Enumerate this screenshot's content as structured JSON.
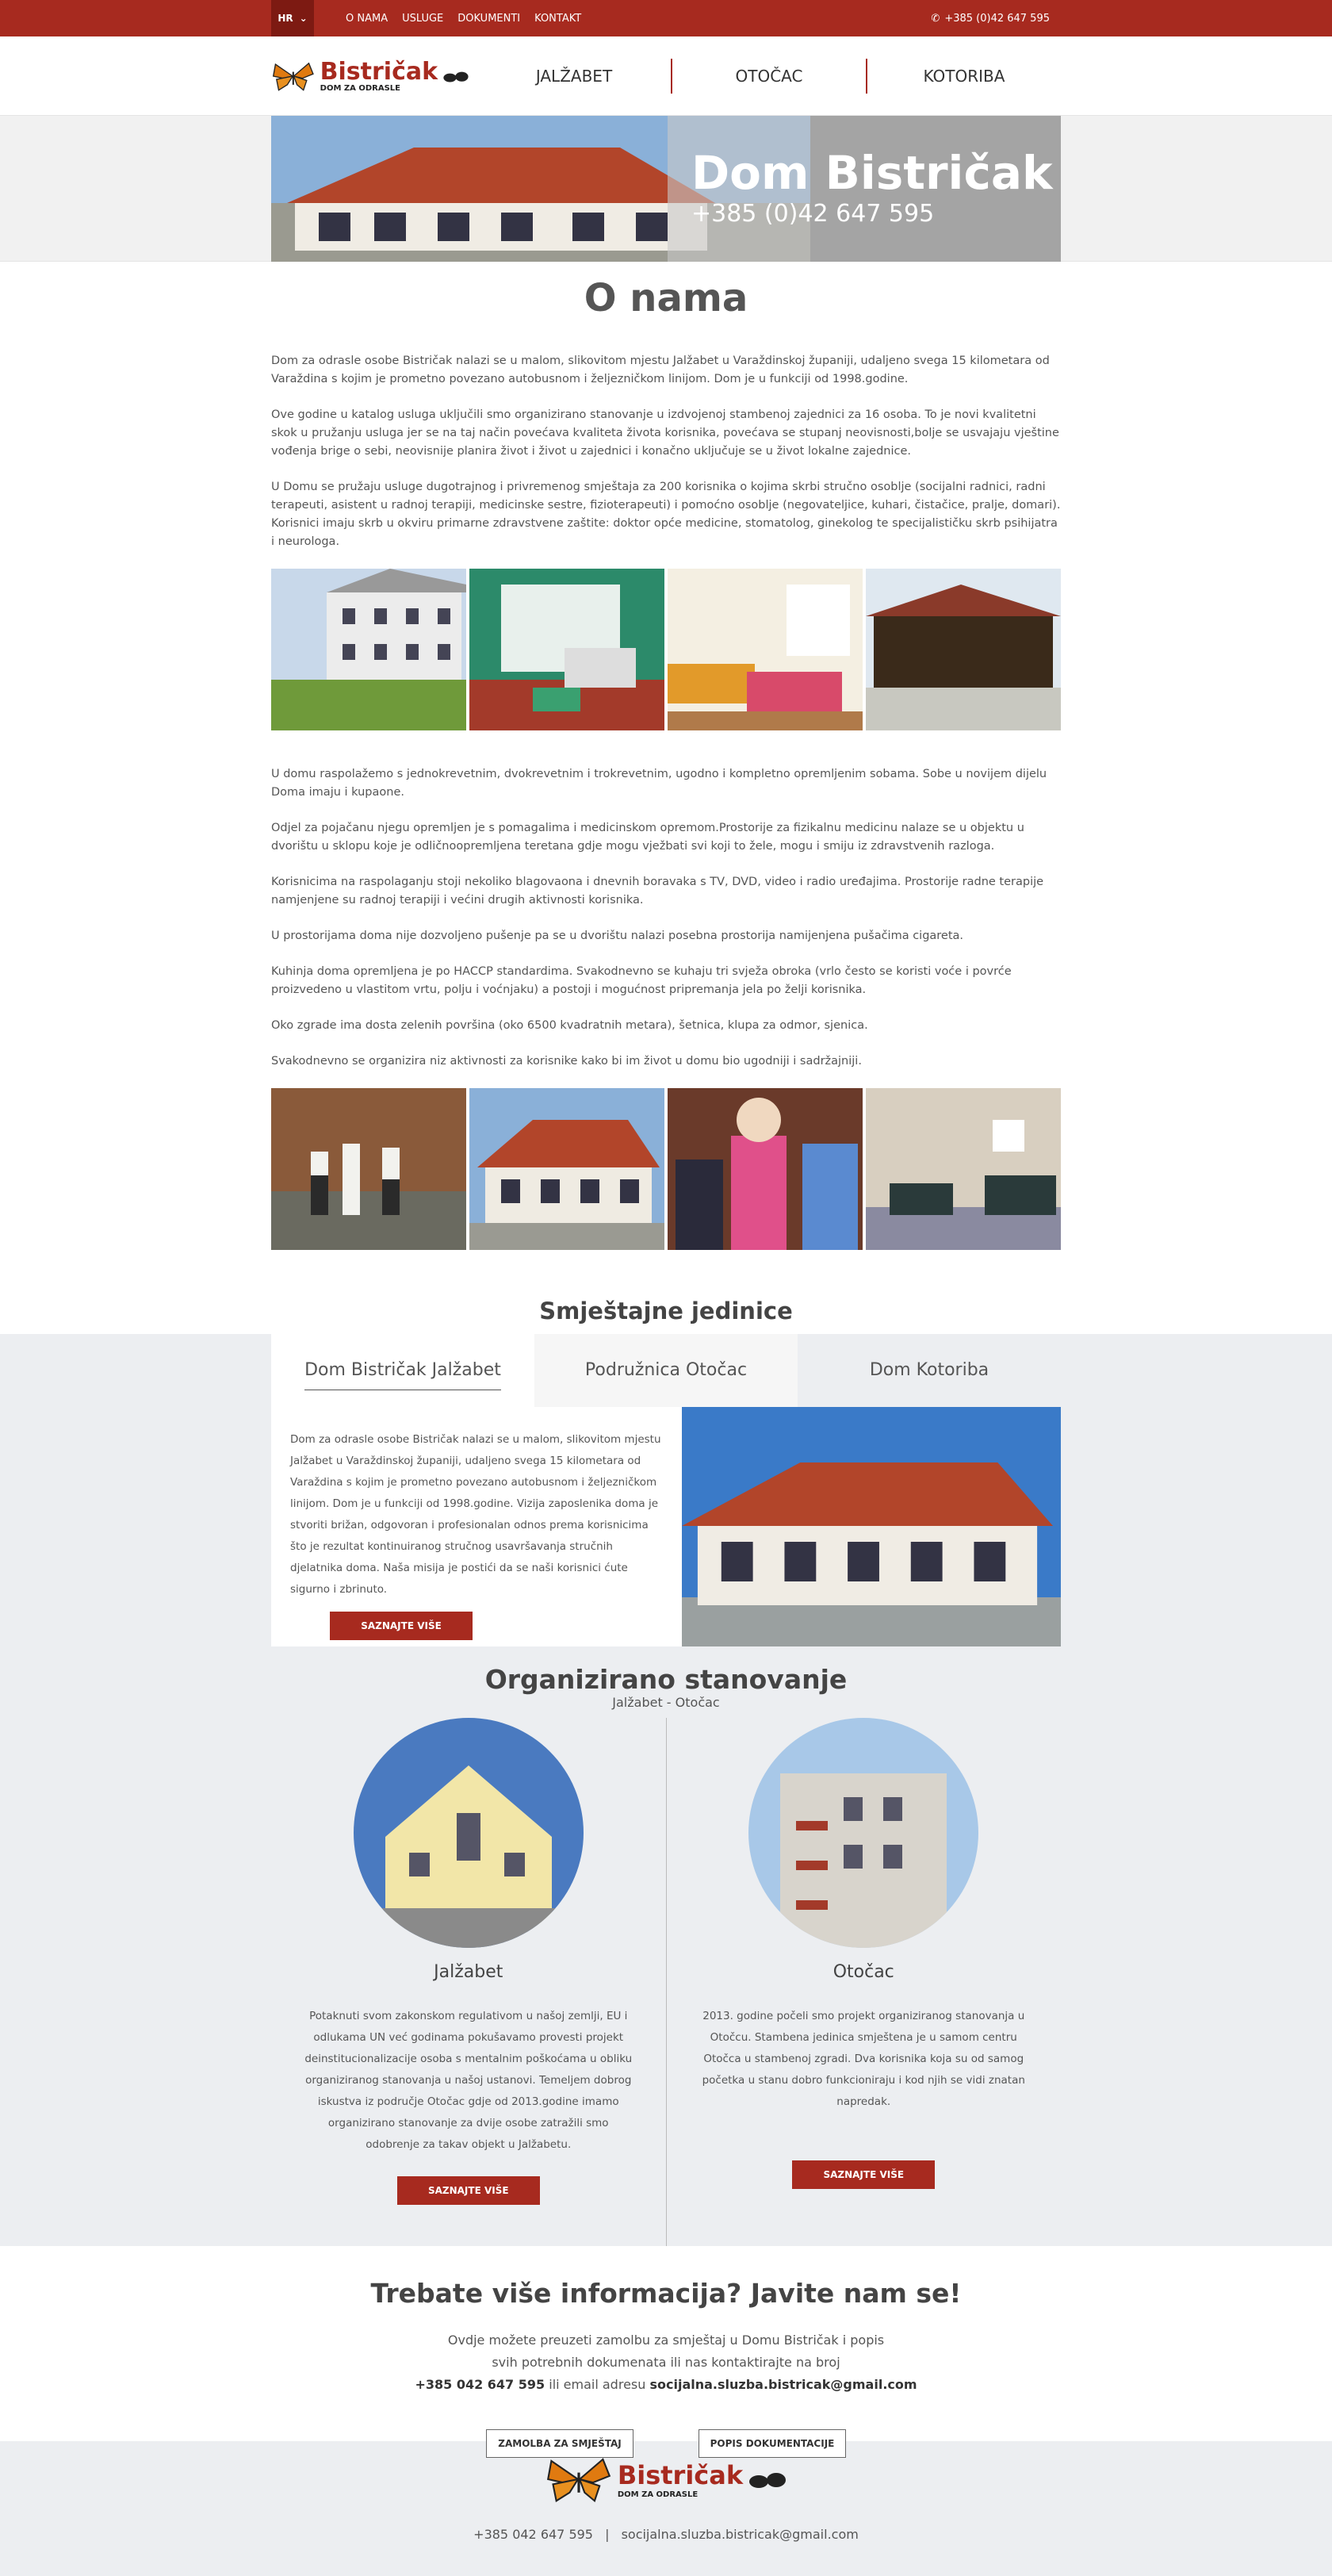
{
  "topbar": {
    "lang": "HR",
    "nav": [
      "O NAMA",
      "USLUGE",
      "DOKUMENTI",
      "KONTAKT"
    ],
    "phone": "+385 (0)42 647 595"
  },
  "header": {
    "logo_name": "Bistričak",
    "logo_sub": "DOM ZA ODRASLE",
    "nav": [
      "JALŽABET",
      "OTOČAC",
      "KOTORIBA"
    ]
  },
  "hero": {
    "title": "Dom Bistričak",
    "phone": "+385 (0)42 647 595"
  },
  "about": {
    "title": "O nama",
    "p1": "Dom za odrasle osobe Bistričak nalazi se u malom, slikovitom mjestu Jalžabet u Varaždinskoj županiji, udaljeno svega 15 kilometara od Varaždina s kojim je prometno povezano autobusnom i željezničkom linijom. Dom je u funkciji od 1998.godine.",
    "p2": "Ove godine u katalog usluga uključili smo organizirano stanovanje u izdvojenoj stambenoj zajednici za 16 osoba. To je novi kvalitetni skok u pružanju usluga jer se na taj način povećava kvaliteta života korisnika, povećava se stupanj neovisnosti,bolje se usvajaju vještine vođenja brige o sebi, neovisnije planira život i život u zajednici i konačno uključuje se u život lokalne zajednice.",
    "p3": "U Domu se pružaju usluge dugotrajnog i privremenog smještaja za 200 korisnika o kojima skrbi stručno osoblje (socijalni radnici, radni terapeuti, asistent u radnoj terapiji, medicinske sestre, fizioterapeuti) i pomoćno osoblje (negovateljice, kuhari, čistačice, pralje, domari). Korisnici imaju skrb u okviru primarne zdravstvene zaštite: doktor opće medicine, stomatolog, ginekolog te specijalističku skrb psihijatra i neurologa.",
    "p4": "U domu raspolažemo s jednokrevetnim, dvokrevetnim i trokrevetnim, ugodno i kompletno opremljenim sobama. Sobe u novijem dijelu Doma imaju i kupaone.",
    "p5": "Odjel za pojačanu njegu opremljen je s pomagalima i medicinskom opremom.Prostorije za fizikalnu medicinu nalaze se u objektu u dvorištu u sklopu koje je odličnoopremljena teretana gdje mogu vježbati svi koji to žele, mogu i smiju iz zdravstvenih razloga.",
    "p6": "Korisnicima na raspolaganju stoji nekoliko blagovaona i dnevnih boravaka s TV, DVD, video i radio uređajima. Prostorije radne terapije namjenjene su radnoj terapiji i većini drugih aktivnosti korisnika.",
    "p7": "U prostorijama doma nije dozvoljeno pušenje pa se u dvorištu nalazi posebna prostorija namijenjena pušačima cigareta.",
    "p8": "Kuhinja doma opremljena je po HACCP standardima. Svakodnevno se kuhaju tri svježa obroka (vrlo često se koristi voće i povrće proizvedeno u vlastitom vrtu, polju i voćnjaku) a postoji i mogućnost pripremanja jela po želji korisnika.",
    "p9": "Oko zgrade ima dosta zelenih površina (oko 6500 kvadratnih metara), šetnica, klupa za odmor, sjenica.",
    "p10": "Svakodnevno se organizira niz aktivnosti za korisnike kako bi im život u domu bio ugodniji i sadržajniji."
  },
  "units": {
    "title": "Smještajne jedinice",
    "tabs": [
      "Dom Bistričak Jalžabet",
      "Podružnica Otočac",
      "Dom Kotoriba"
    ],
    "desc": "Dom za odrasle osobe Bistričak nalazi se u malom, slikovitom mjestu Jalžabet u Varaždinskoj županiji, udaljeno svega 15 kilometara od Varaždina s kojim je prometno povezano autobusnom i željezničkom linijom. Dom je u funkciji od 1998.godine. Vizija zaposlenika doma je stvoriti brižan, odgovoran i profesionalan odnos prema korisnicima što je rezultat kontinuiranog stručnog usavršavanja stručnih djelatnika doma. Naša misija je postići da se naši korisnici ćute sigurno i zbrinuto.",
    "button": "SAZNAJTE VIŠE"
  },
  "organized": {
    "title": "Organizirano stanovanje",
    "subtitle": "Jalžabet - Otočac",
    "left_title": "Jalžabet",
    "left_text": "Potaknuti svom zakonskom regulativom u našoj zemlji, EU i odlukama UN već godinama pokušavamo provesti projekt deinstitucionalizacije osoba s mentalnim poškoćama u obliku organiziranog stanovanja u našoj ustanovi. Temeljem dobrog iskustva iz područje Otočac gdje od 2013.godine imamo organizirano stanovanje za dvije osobe zatražili smo odobrenje za takav objekt u Jalžabetu.",
    "right_title": "Otočac",
    "right_text": "2013. godine počeli smo projekt organiziranog stanovanja u Otočcu. Stambena jedinica smještena je u samom centru Otočca u stambenoj zgradi. Dva korisnika koja su od samog početka u stanu dobro funkcioniraju i kod njih se vidi znatan napredak.",
    "button": "SAZNAJTE VIŠE"
  },
  "cta": {
    "title": "Trebate više informacija? Javite nam se!",
    "line1": "Ovdje možete preuzeti zamolbu za smještaj u Domu Bistričak i popis",
    "line2": "svih potrebnih dokumenata ili nas kontaktirajte na broj",
    "phone": "+385 042 647 595",
    "mid": " ili email adresu ",
    "email": "socijalna.sluzba.bistricak@gmail.com",
    "btn1": "ZAMOLBA ZA SMJEŠTAJ",
    "btn2": "POPIS DOKUMENTACIJE"
  },
  "footer": {
    "phone": "+385 042 647 595",
    "sep": "|",
    "email": "socijalna.sluzba.bistricak@gmail.com"
  },
  "colors": {
    "brand_red": "#a72a1f",
    "dark_red": "#7d1a12",
    "gray_bg": "#eceef1"
  }
}
